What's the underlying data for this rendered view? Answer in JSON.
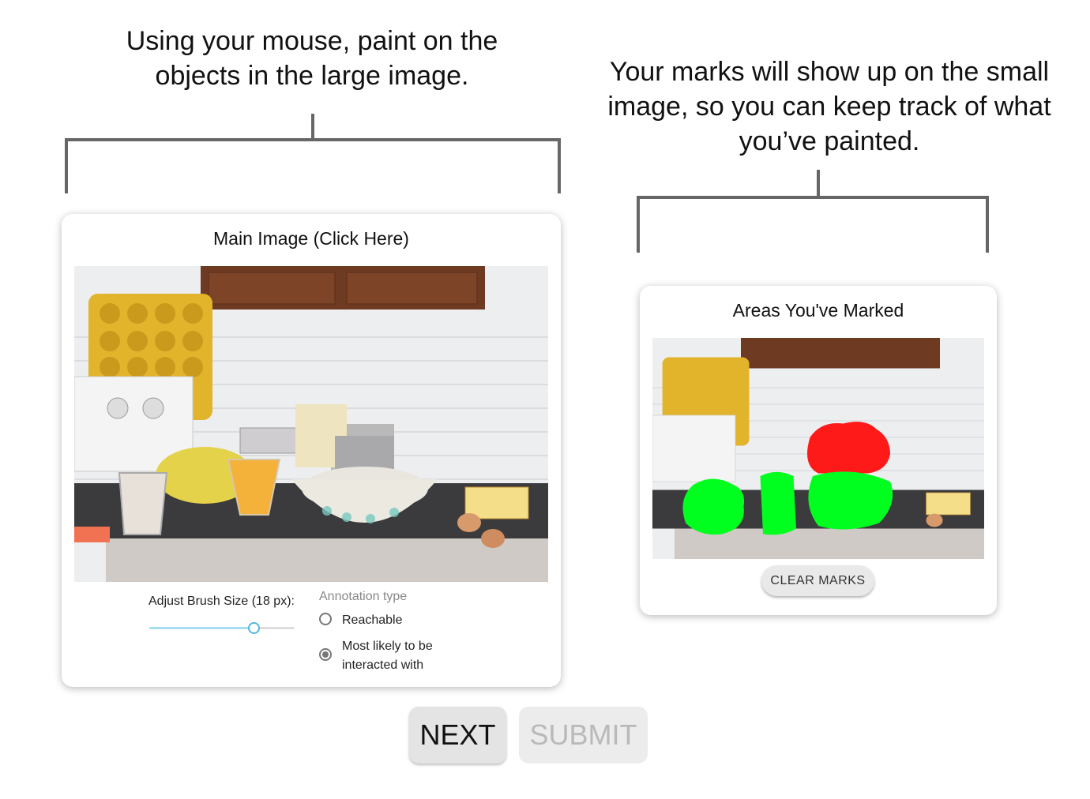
{
  "instructions": {
    "left": "Using your mouse, paint on the objects in the large image.",
    "right": "Your marks will show up on the small image, so you can keep track of what you’ve painted."
  },
  "main_card": {
    "title": "Main Image (Click Here)",
    "brush_label": "Adjust Brush Size (18 px):",
    "brush_size_fraction": 0.7,
    "annotation_heading": "Annotation type",
    "options": [
      {
        "label": "Reachable",
        "selected": false
      },
      {
        "label": "Most likely to be interacted with",
        "selected": true
      }
    ]
  },
  "marked_card": {
    "title": "Areas You've Marked",
    "clear_label": "CLEAR MARKS",
    "mark_colors": {
      "reachable": "#ff0000",
      "interacted": "#00ff00"
    }
  },
  "buttons": {
    "next": "NEXT",
    "submit": "SUBMIT"
  },
  "icons": [
    "radio-unselected-icon",
    "radio-selected-icon",
    "slider-thumb-icon"
  ]
}
